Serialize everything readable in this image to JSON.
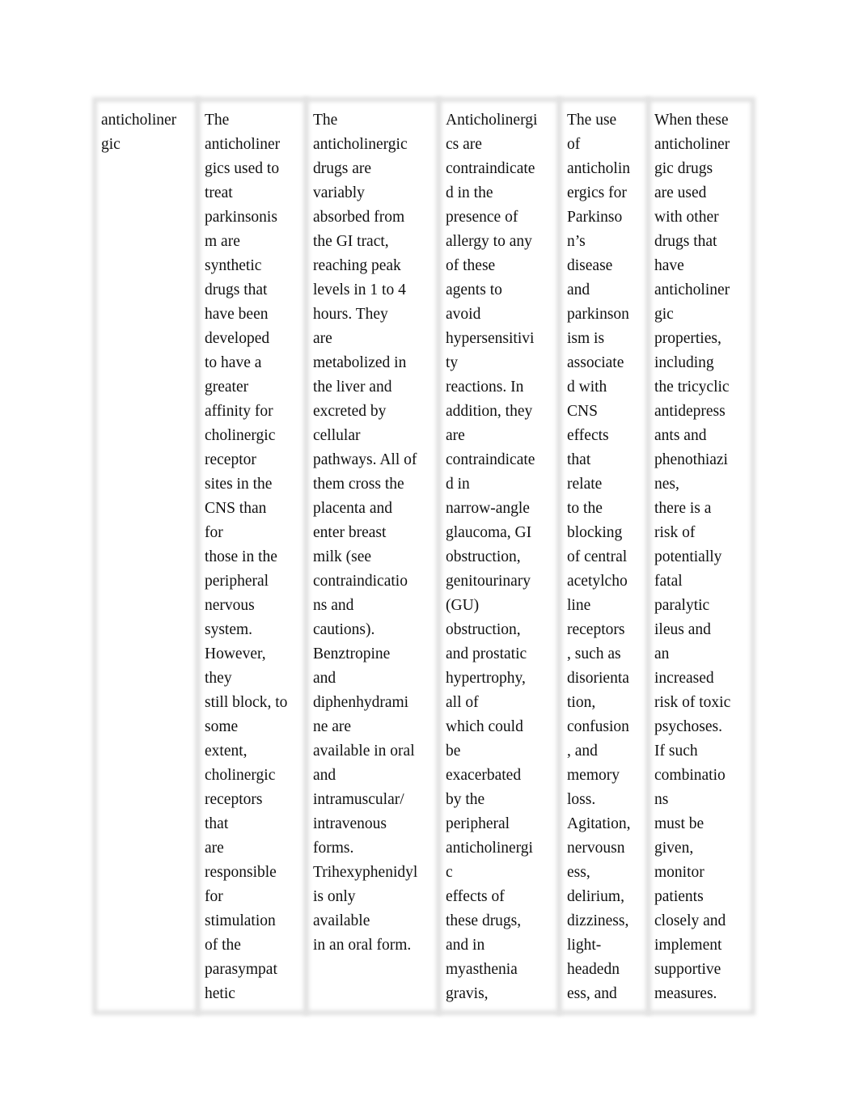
{
  "table": {
    "columns": [
      {
        "lines": [
          "anticholiner",
          "gic"
        ]
      },
      {
        "lines": [
          "The",
          "anticholiner",
          "gics used to",
          "treat",
          "parkinsonis",
          "m are",
          "synthetic",
          "drugs that",
          "have been",
          "developed",
          "to have a",
          "greater",
          "affinity for",
          "cholinergic",
          "receptor",
          "sites in the",
          "CNS than",
          "for",
          "those in the",
          "peripheral",
          "nervous",
          "system.",
          "However,",
          "they",
          "still block, to",
          "some",
          "extent,",
          "cholinergic",
          "receptors",
          "that",
          "are",
          "responsible",
          "for",
          "stimulation",
          "of the",
          "parasympat",
          "hetic"
        ]
      },
      {
        "lines": [
          "The",
          "anticholinergic",
          "drugs are",
          "variably",
          "absorbed from",
          "the GI tract,",
          "reaching peak",
          "levels in 1 to 4",
          "hours. They",
          "are",
          "metabolized in",
          "the liver and",
          "excreted by",
          "cellular",
          "pathways. All of",
          "them cross the",
          "placenta and",
          "enter breast",
          "milk (see",
          "contraindicatio",
          "ns and",
          "cautions).",
          "Benztropine",
          "and",
          "diphenhydrami",
          "ne are",
          "available in oral",
          "and",
          "intramuscular/",
          "intravenous",
          "forms.",
          "Trihexyphenidyl",
          "is only",
          "available",
          "in an oral form."
        ]
      },
      {
        "lines": [
          "Anticholinergi",
          "cs are",
          "contraindicate",
          "d in the",
          "presence of",
          "allergy to any",
          "of these",
          "agents to",
          "avoid",
          "hypersensitivi",
          "ty",
          "reactions. In",
          "addition, they",
          "are",
          "contraindicate",
          "d in",
          "narrow-angle",
          "glaucoma, GI",
          "obstruction,",
          "genitourinary",
          "(GU)",
          "obstruction,",
          "and prostatic",
          "hypertrophy,",
          "all of",
          "which could",
          "be",
          "exacerbated",
          "by the",
          "peripheral",
          "anticholinergi",
          "c",
          "effects of",
          "these drugs,",
          "and in",
          "myasthenia",
          "gravis,"
        ]
      },
      {
        "lines": [
          "The use",
          "of",
          "anticholin",
          "ergics for",
          "Parkinso",
          "n’s",
          "disease",
          "and",
          "parkinson",
          "ism is",
          "associate",
          "d with",
          "CNS",
          "effects",
          "that",
          "relate",
          "to the",
          "blocking",
          "of central",
          "acetylcho",
          "line",
          "receptors",
          ", such as",
          "disorienta",
          "tion,",
          "confusion",
          ", and",
          "memory",
          "loss.",
          "Agitation,",
          "nervousn",
          "ess,",
          "delirium,",
          "dizziness,",
          "light-",
          "headedn",
          "ess, and"
        ]
      },
      {
        "lines": [
          "When these",
          "anticholiner",
          "gic drugs",
          "are used",
          "with other",
          "drugs that",
          "have",
          "anticholiner",
          "gic",
          "properties,",
          "including",
          "the tricyclic",
          "antidepress",
          "ants and",
          "phenothiazi",
          "nes,",
          "there is a",
          "risk of",
          "potentially",
          "fatal",
          "paralytic",
          "ileus and",
          "an",
          "increased",
          "risk of toxic",
          "psychoses.",
          "If such",
          "combinatio",
          "ns",
          "must be",
          "given,",
          "monitor",
          "patients",
          "closely and",
          "implement",
          "supportive",
          "measures."
        ]
      }
    ]
  }
}
